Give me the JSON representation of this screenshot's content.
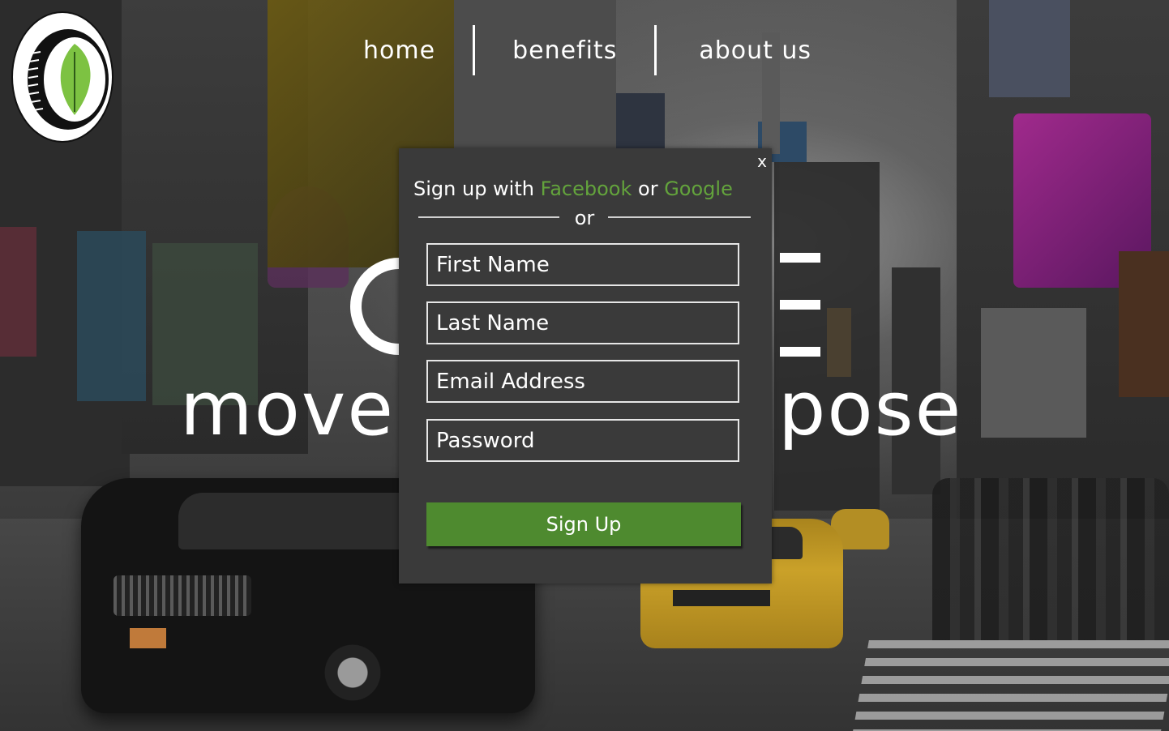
{
  "nav": {
    "items": [
      {
        "label": "home"
      },
      {
        "label": "benefits"
      },
      {
        "label": "about us"
      }
    ]
  },
  "hero": {
    "tagline": "move with purpose",
    "tagline_visible_left": "move",
    "tagline_visible_right": "pose"
  },
  "modal": {
    "close_label": "x",
    "title_prefix": "Sign up with ",
    "facebook_label": "Facebook",
    "title_or": " or ",
    "google_label": "Google",
    "divider_or": "or",
    "fields": {
      "first_name": {
        "placeholder": "First Name",
        "value": ""
      },
      "last_name": {
        "placeholder": "Last Name",
        "value": ""
      },
      "email": {
        "placeholder": "Email Address",
        "value": ""
      },
      "password": {
        "placeholder": "Password",
        "value": ""
      }
    },
    "submit_label": "Sign Up"
  },
  "colors": {
    "accent_green": "#63a33c",
    "button_green": "#4e8a2f",
    "modal_bg": "#3a3a3a",
    "logo_leaf": "#7dc242"
  },
  "icons": {
    "logo": "tire-leaf-logo-icon",
    "close": "close-icon"
  }
}
